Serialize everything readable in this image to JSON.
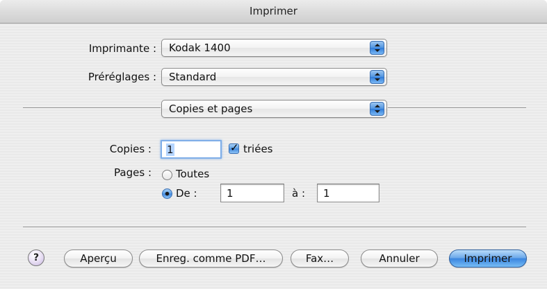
{
  "window": {
    "title": "Imprimer"
  },
  "printer": {
    "label": "Imprimante :",
    "value": "Kodak 1400"
  },
  "presets": {
    "label": "Préréglages :",
    "value": "Standard"
  },
  "panel": {
    "value": "Copies et pages"
  },
  "copies": {
    "label": "Copies :",
    "value": "1",
    "collated_label": "triées",
    "collated": true
  },
  "pages": {
    "label": "Pages :",
    "all_label": "Toutes",
    "all_selected": false,
    "from_label": "De :",
    "from_selected": true,
    "from_value": "1",
    "to_label": "à :",
    "to_value": "1"
  },
  "buttons": {
    "help": "?",
    "preview": "Aperçu",
    "save_pdf": "Enreg. comme PDF…",
    "fax": "Fax…",
    "cancel": "Annuler",
    "print": "Imprimer"
  },
  "colors": {
    "accent": "#3b86df",
    "focus_ring": "#7faee8",
    "selection": "#b5d5ff"
  }
}
